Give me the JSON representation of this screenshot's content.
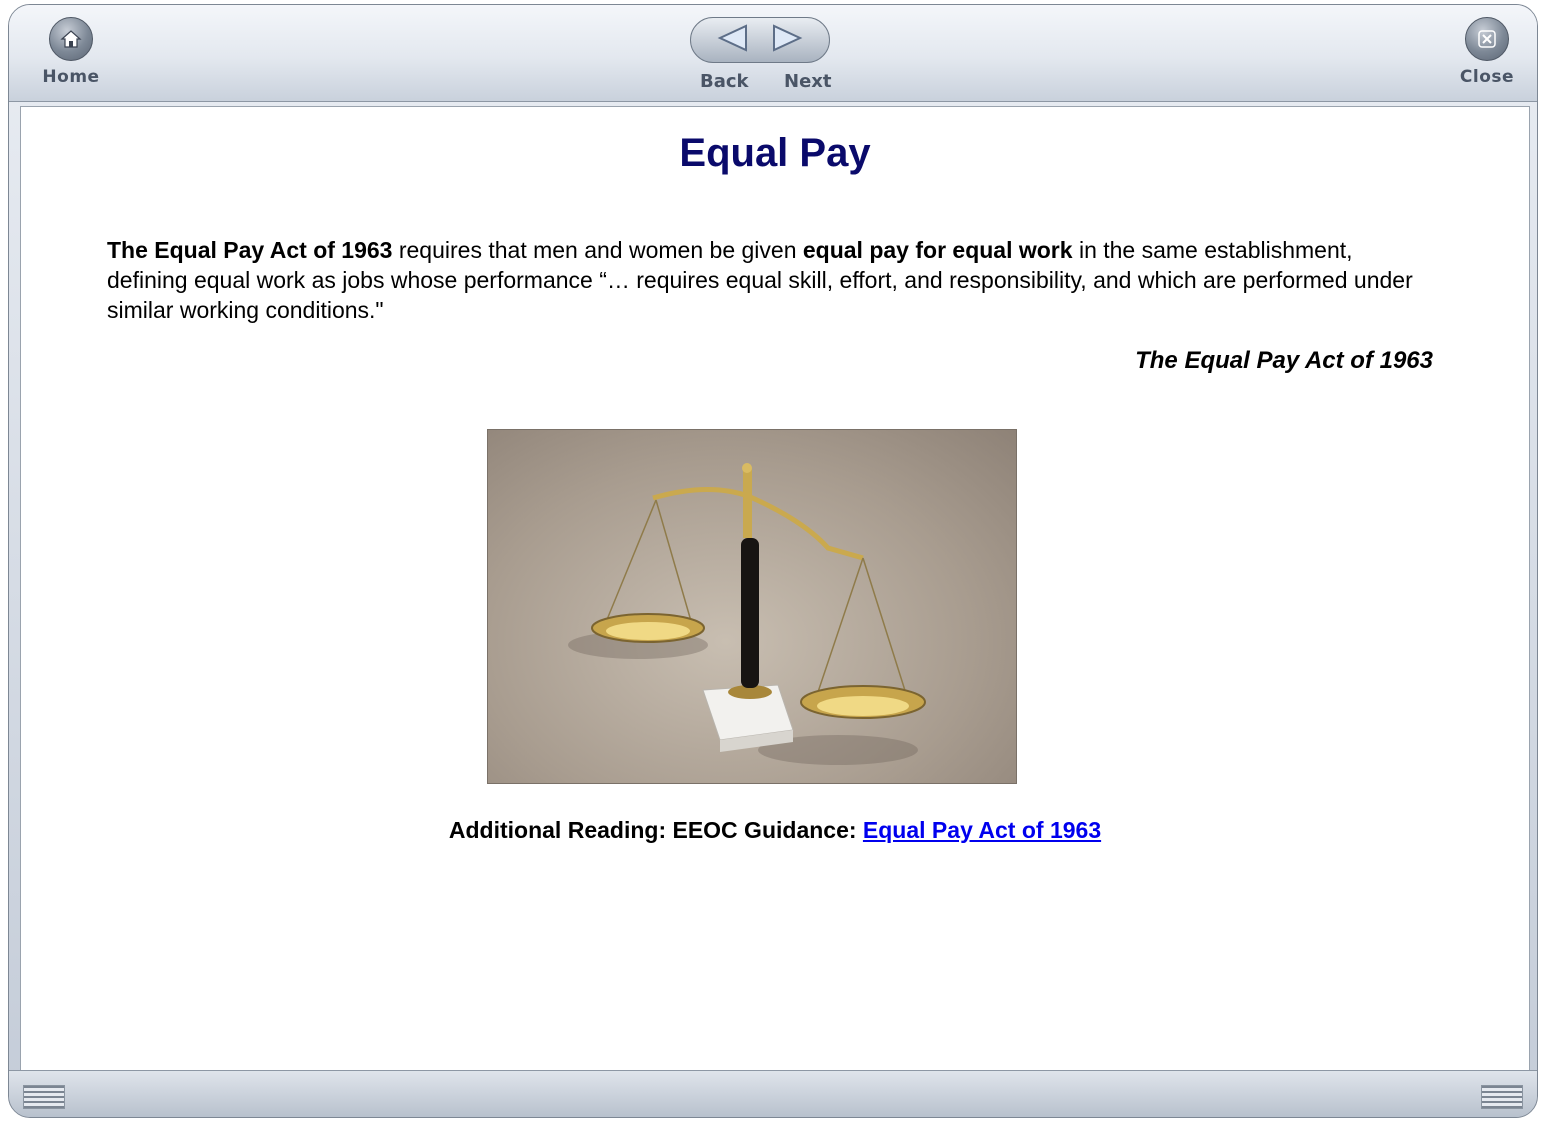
{
  "toolbar": {
    "home_label": "Home",
    "back_label": "Back",
    "next_label": "Next",
    "close_label": "Close"
  },
  "main": {
    "title": "Equal Pay",
    "paragraph": {
      "bold_1": "The Equal Pay Act of 1963",
      "text_1": " requires that men and women be given ",
      "bold_2": "equal pay for equal work",
      "text_2": " in the same establishment, defining equal work as jobs whose performance “… requires equal skill, effort, and responsibility, and which are performed under similar working conditions.\""
    },
    "attribution": "The Equal Pay Act of 1963",
    "image_icon": "scales-of-justice-image",
    "reading_label": "Additional Reading: EEOC Guidance: ",
    "reading_link": "Equal Pay Act of 1963"
  },
  "colors": {
    "title": "#0a0a6b",
    "link": "#0000ee"
  }
}
